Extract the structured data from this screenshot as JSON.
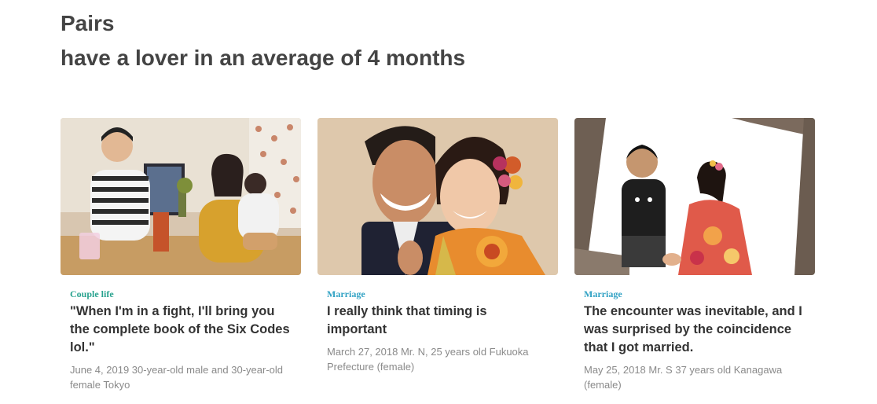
{
  "heading": {
    "line1": "Pairs",
    "line2": "have a lover in an average of 4 months"
  },
  "cards": [
    {
      "category": "Couple life",
      "category_color": "#2aa38f",
      "title": "\"When I'm in a fight, I'll bring you the complete book of the Six Codes lol.\"",
      "meta": "June 4, 2019 30-year-old male and 30-year-old female Tokyo",
      "image": "couple-at-home-photo"
    },
    {
      "category": "Marriage",
      "category_color": "#31a2c4",
      "title": "I really think that timing is important",
      "meta": "March 27, 2018 Mr. N, 25 years old Fukuoka Prefecture (female)",
      "image": "smiling-couple-kimono-photo"
    },
    {
      "category": "Marriage",
      "category_color": "#31a2c4",
      "title": "The encounter was inevitable, and I was surprised by the coincidence that I got married.",
      "meta": "May 25, 2018 Mr. S 37 years old Kanagawa (female)",
      "image": "wedding-couple-kimono-photo"
    }
  ]
}
